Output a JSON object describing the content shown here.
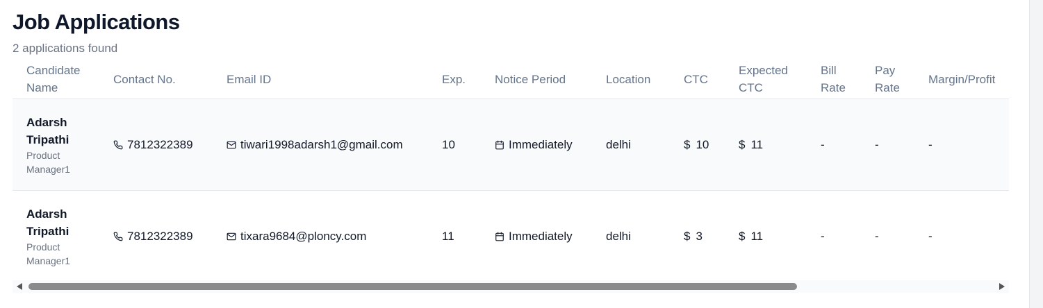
{
  "page": {
    "title": "Job Applications",
    "subtitle": "2 applications found"
  },
  "table": {
    "headers": {
      "candidate_name_1": "Candidate",
      "candidate_name_2": "Name",
      "contact": "Contact No.",
      "email": "Email ID",
      "exp": "Exp.",
      "notice": "Notice Period",
      "location": "Location",
      "ctc": "CTC",
      "expected_ctc_1": "Expected",
      "expected_ctc_2": "CTC",
      "bill_rate_1": "Bill",
      "bill_rate_2": "Rate",
      "pay_rate_1": "Pay",
      "pay_rate_2": "Rate",
      "margin": "Margin/Profit"
    },
    "rows": [
      {
        "name_first": "Adarsh",
        "name_last": "Tripathi",
        "role_1": "Product",
        "role_2": "Manager1",
        "contact": "7812322389",
        "email": "tiwari1998adarsh1@gmail.com",
        "exp": "10",
        "notice": "Immediately",
        "location": "delhi",
        "ctc_currency": "$",
        "ctc": "10",
        "ectc_currency": "$",
        "ectc": "11",
        "bill_rate": "-",
        "pay_rate": "-",
        "margin": "-"
      },
      {
        "name_first": "Adarsh",
        "name_last": "Tripathi",
        "role_1": "Product",
        "role_2": "Manager1",
        "contact": "7812322389",
        "email": "tixara9684@ploncy.com",
        "exp": "11",
        "notice": "Immediately",
        "location": "delhi",
        "ctc_currency": "$",
        "ctc": "3",
        "ectc_currency": "$",
        "ectc": "11",
        "bill_rate": "-",
        "pay_rate": "-",
        "margin": "-"
      }
    ]
  },
  "icons": {
    "phone": "phone-icon",
    "mail": "mail-icon",
    "calendar": "calendar-icon"
  },
  "colors": {
    "row_alt_bg": "#f9fafb",
    "header_text": "#64748b",
    "scroll_thumb": "#8a8a8a"
  }
}
